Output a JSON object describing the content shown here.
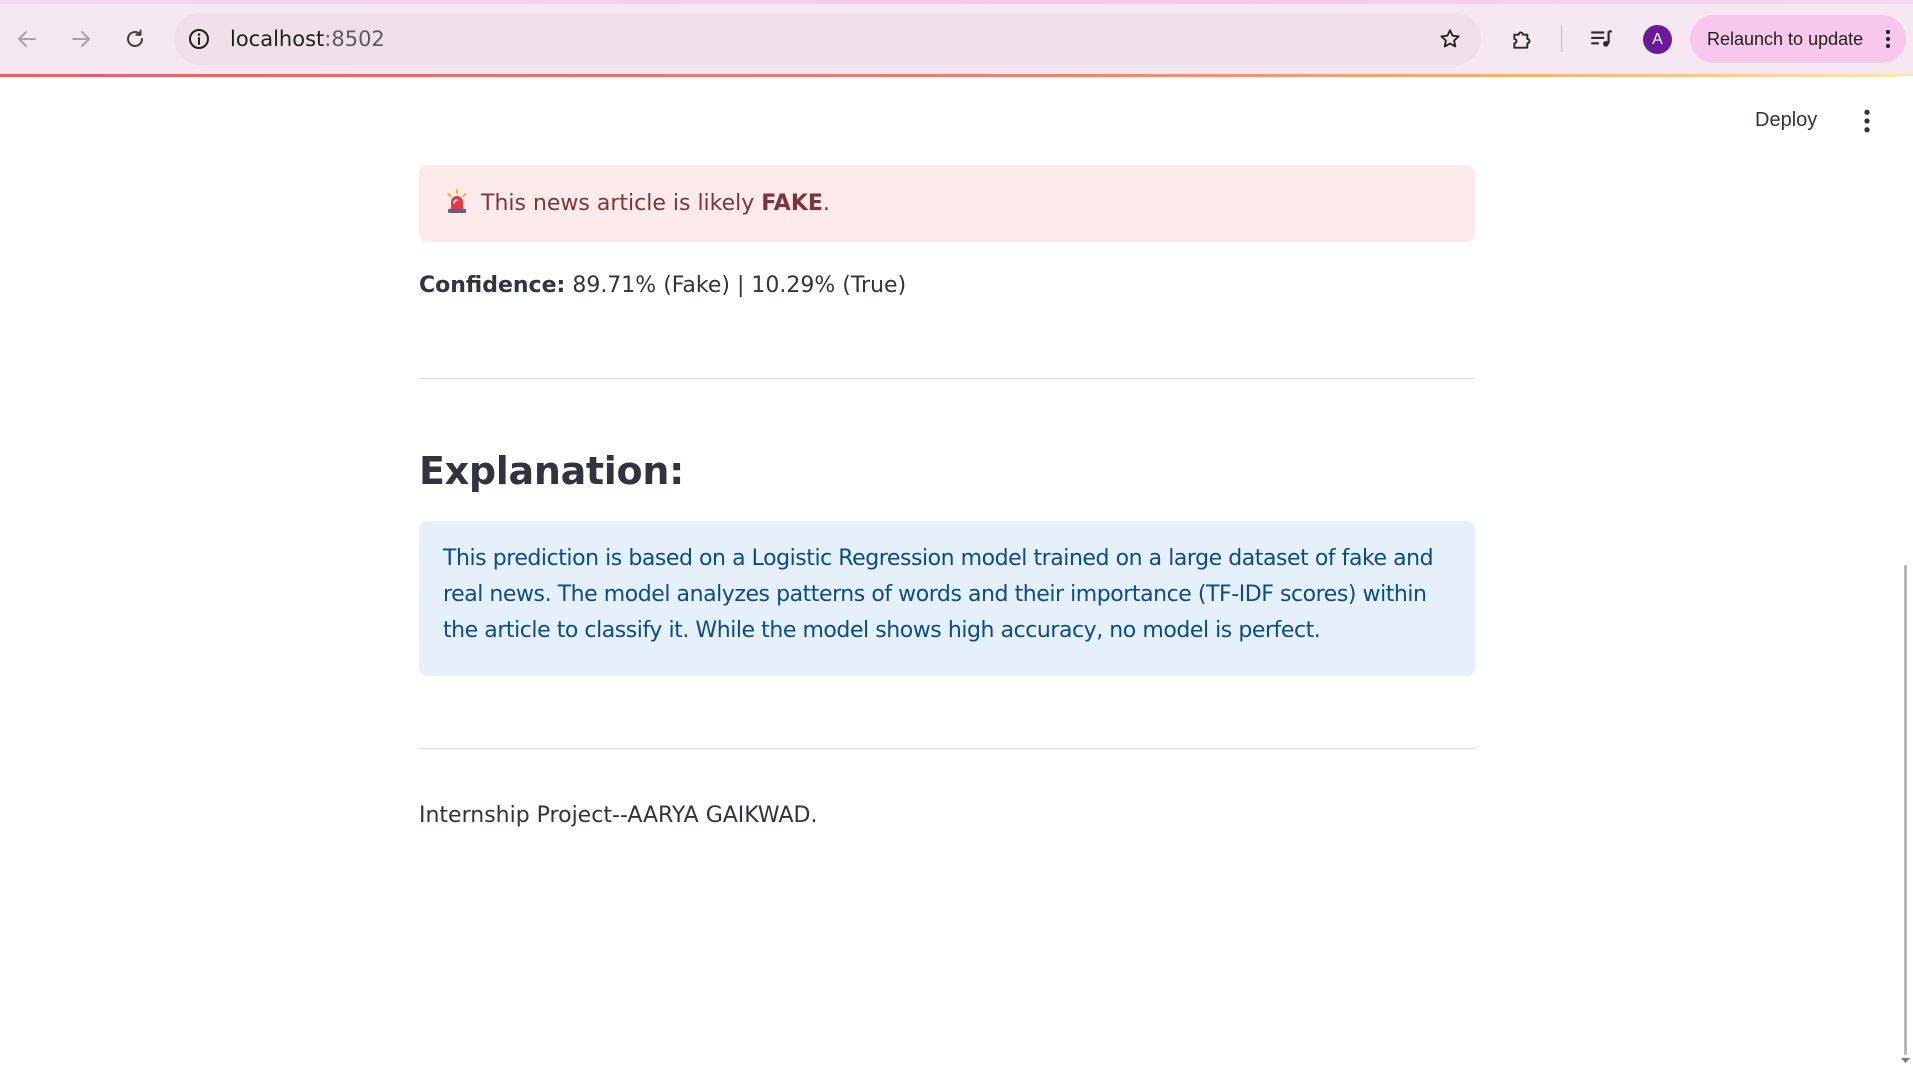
{
  "browser": {
    "url_host": "localhost",
    "url_port": ":8502",
    "relaunch_label": "Relaunch to update",
    "avatar_initial": "A",
    "icons": {
      "back": "arrow-left-icon",
      "forward": "arrow-right-icon",
      "reload": "reload-icon",
      "site_info": "info-icon",
      "bookmark": "star-icon",
      "extensions": "puzzle-icon",
      "media": "media-queue-icon",
      "menu": "vertical-dots-icon"
    }
  },
  "app_header": {
    "deploy_label": "Deploy",
    "menu_icon": "vertical-dots-icon"
  },
  "result": {
    "alert_icon": "siren-icon",
    "alert_prefix": "This news article is likely ",
    "alert_verdict": "FAKE",
    "alert_suffix": ".",
    "confidence_label": "Confidence:",
    "confidence_value": " 89.71% (Fake) | 10.29% (True)"
  },
  "explanation": {
    "heading": "Explanation:",
    "text": "This prediction is based on a Logistic Regression model trained on a large dataset of fake and real news. The model analyzes patterns of words and their importance (TF-IDF scores) within the article to classify it. While the model shows high accuracy, no model is perfect."
  },
  "footer": {
    "text": "Internship Project--AARYA GAIKWAD."
  },
  "colors": {
    "alert_bg": "#fdebec",
    "alert_text": "#7d353b",
    "info_bg": "#e6f0fb",
    "info_text": "#0c4a88",
    "body_text": "#31333f",
    "relaunch_bg": "#f7c8ec",
    "avatar_bg": "#6a1b9a"
  }
}
